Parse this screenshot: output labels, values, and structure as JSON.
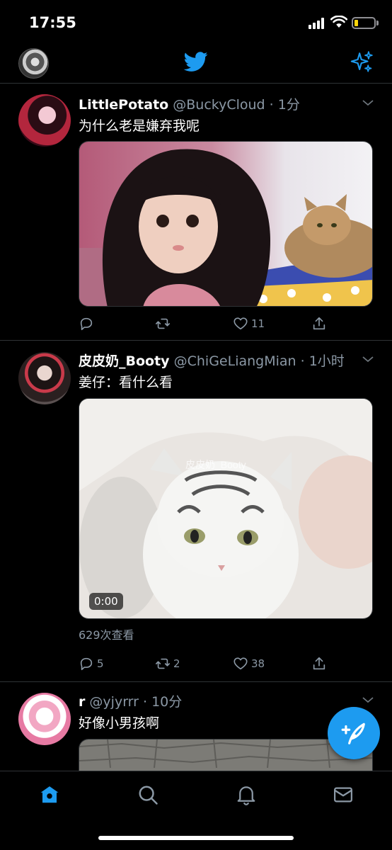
{
  "status_bar": {
    "time": "17:55"
  },
  "nav": {
    "avatar_icon": "user-avatar",
    "logo_icon": "twitter-bird-icon",
    "sparkle_icon": "sparkle-icon"
  },
  "colors": {
    "accent": "#1d9bf0",
    "secondary_text": "#8b98a5",
    "divider": "#2f3336"
  },
  "tweets": [
    {
      "name": "LittlePotato",
      "handle": "@BuckyCloud",
      "time": "· 1分",
      "text": "为什么老是嫌弃我呢",
      "media_type": "image",
      "actions": {
        "reply": "",
        "retweet": "",
        "like": "11"
      }
    },
    {
      "name": "皮皮奶_Booty",
      "handle": "@ChiGeLiangMian",
      "time": "· 1小时",
      "text": "姜仔：看什么看",
      "media_type": "video",
      "video_time": "0:00",
      "views": "629次查看",
      "actions": {
        "reply": "5",
        "retweet": "2",
        "like": "38"
      }
    },
    {
      "name": "r",
      "handle": "@yjyrrr",
      "time": "· 10分",
      "text": "好像小男孩啊",
      "media_type": "image"
    }
  ],
  "fab": {
    "icon": "compose-tweet-icon"
  },
  "tab_bar": {
    "items": [
      {
        "icon": "home-icon",
        "active": true
      },
      {
        "icon": "search-icon",
        "active": false
      },
      {
        "icon": "bell-icon",
        "active": false
      },
      {
        "icon": "mail-icon",
        "active": false
      }
    ]
  }
}
